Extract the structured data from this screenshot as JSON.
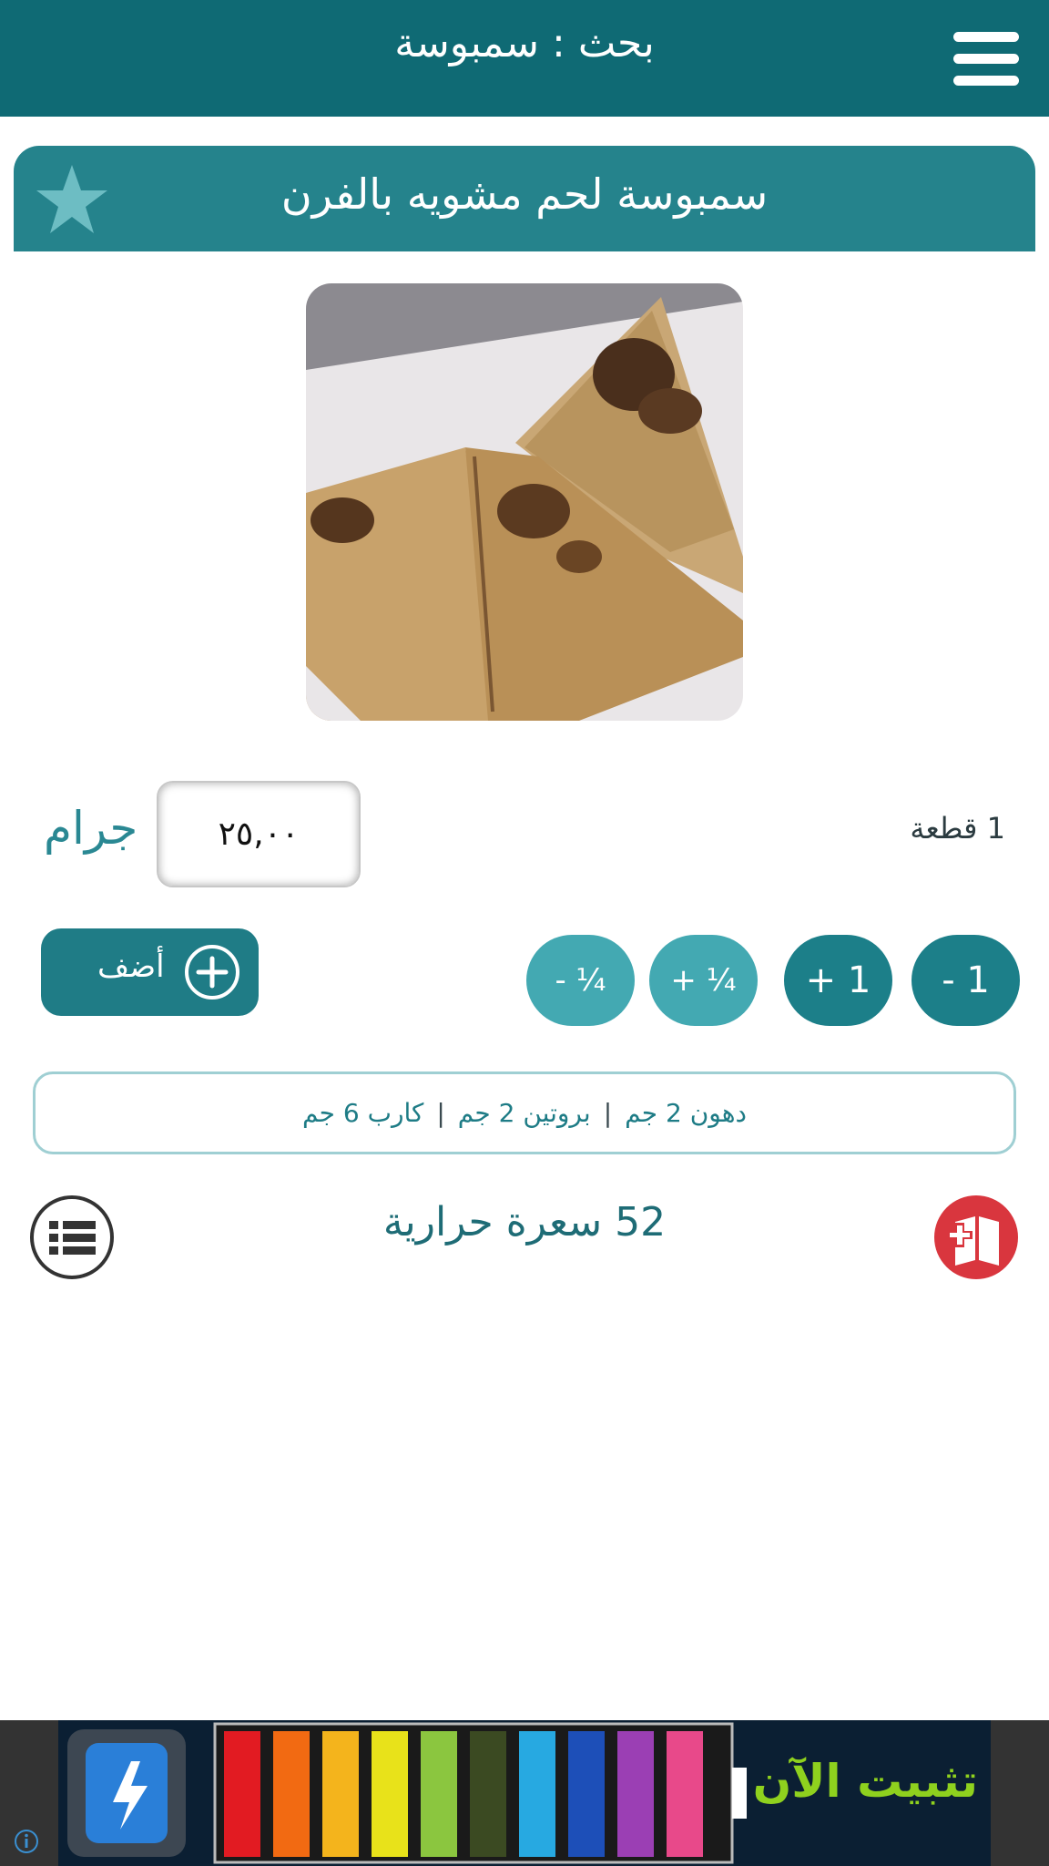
{
  "header": {
    "title": "بحث : سمبوسة",
    "menu_icon": "hamburger-menu-icon"
  },
  "food": {
    "name": "سمبوسة لحم مشويه بالفرن",
    "favorite_icon": "star-icon",
    "photo_alt": "سمبوسة لحم مشويه بالفرن"
  },
  "quantity": {
    "value": "٢٥,٠٠",
    "unit": "جرام",
    "piece_label": "1 قطعة"
  },
  "stepper": {
    "minus_one": "- 1",
    "plus_one": "+ 1",
    "plus_quarter": "+ ¼",
    "minus_quarter": "- ¼"
  },
  "add_button": {
    "label": "أضف",
    "icon": "plus-circle-icon"
  },
  "nutrition": {
    "fat": "دهون 2 جم",
    "protein": "بروتين 2 جم",
    "carb": "كارب 6 جم",
    "separator": "|"
  },
  "calories": {
    "text": "52 سعرة حرارية"
  },
  "icons": {
    "list": "list-icon",
    "diary": "add-diary-icon"
  },
  "ad": {
    "cta": "تثبيت الآن",
    "info_icon": "info-icon"
  },
  "colors": {
    "header_bg": "#0f6a74",
    "banner_bg": "#25838c",
    "primary": "#1f7c86",
    "light": "#43a9b2",
    "diary_red": "#d9363e",
    "ad_cta": "#8fd11e"
  }
}
